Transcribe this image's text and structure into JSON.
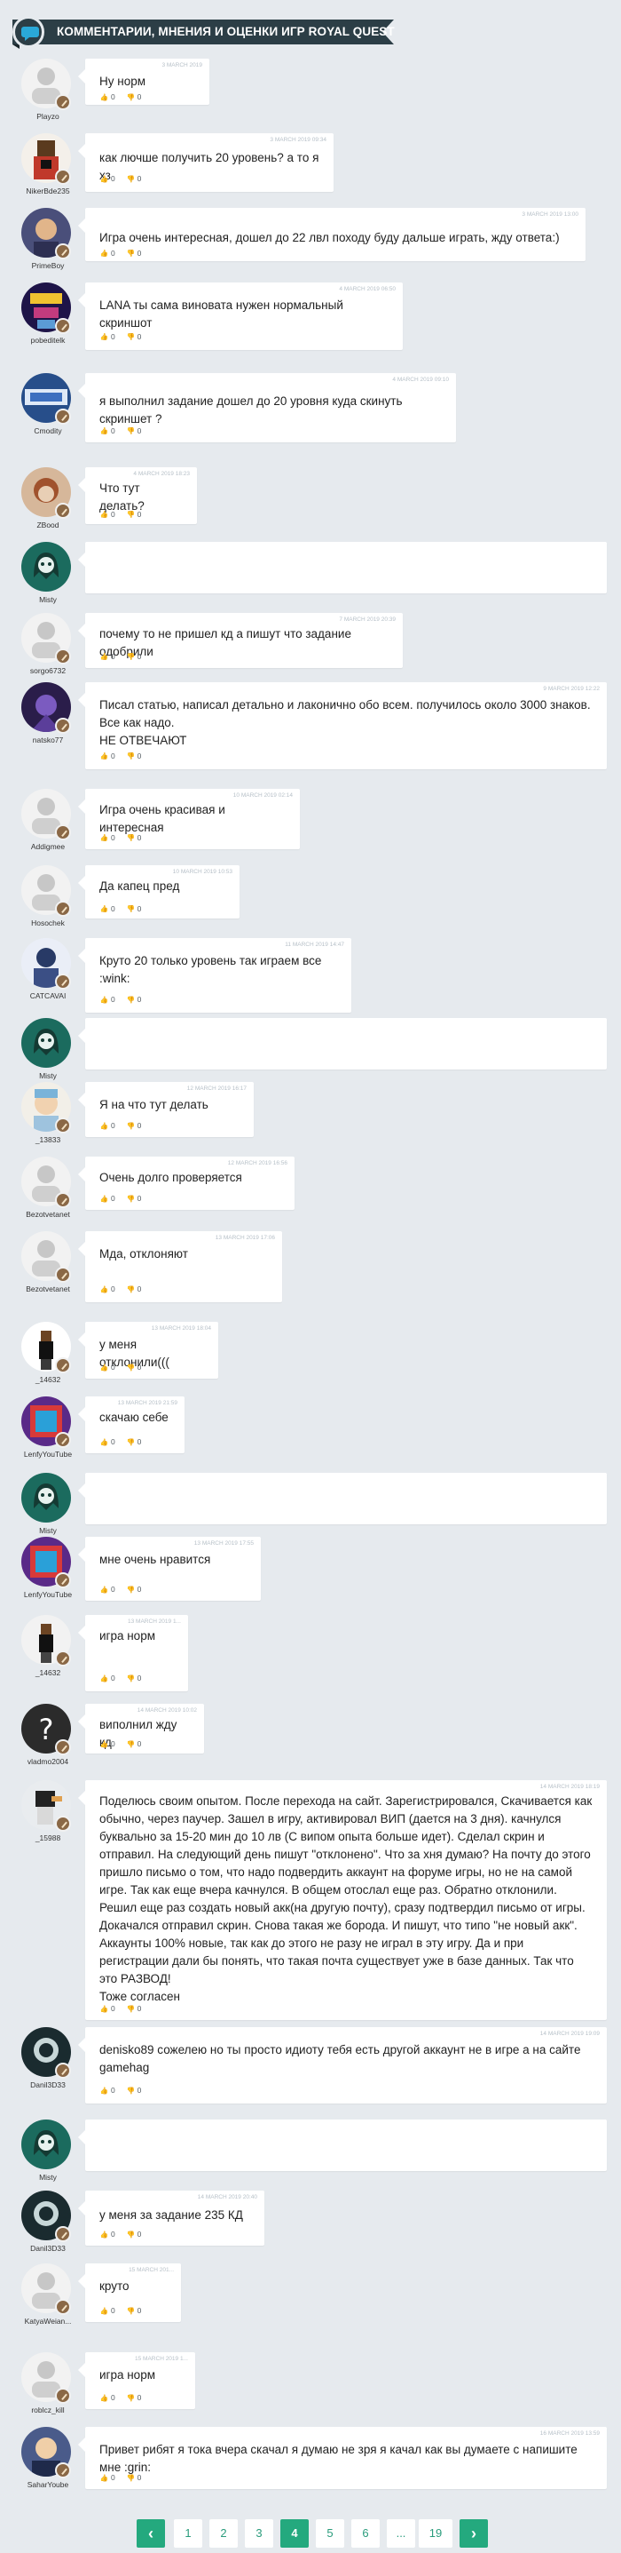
{
  "header": {
    "title": "КОММЕНТАРИИ, МНЕНИЯ И ОЦЕНКИ ИГР ROYAL QUEST"
  },
  "colors": {
    "accent": "#24a97e",
    "header_bg": "#2c3e46",
    "page_bg": "#e6eaee"
  },
  "comments": [
    {
      "user": "Playzo",
      "date": "3 MARCH 2019",
      "text": "Ну норм",
      "likes": "0",
      "dislikes": "0"
    },
    {
      "user": "NikerBde235",
      "date": "3 MARCH 2019 09:34",
      "text": "как лючше получить 20 уровень? а то я хз",
      "likes": "0",
      "dislikes": "0"
    },
    {
      "user": "PrimeBoy",
      "date": "3 MARCH 2019 13:00",
      "text": "Игра очень интересная, дошел до 22 лвл походу буду дальше играть, жду ответа:)",
      "likes": "0",
      "dislikes": "0"
    },
    {
      "user": "pobeditelk",
      "date": "4 MARCH 2019 06:50",
      "text": "LANA ты сама виновата нужен нормальный скриншот",
      "likes": "0",
      "dislikes": "0"
    },
    {
      "user": "Cmodity",
      "date": "4 MARCH 2019 09:10",
      "text": "я выполнил задание дошел до 20 уровня куда скинуть скриншет ?",
      "likes": "0",
      "dislikes": "0"
    },
    {
      "user": "ZBood",
      "date": "4 MARCH 2019 18:23",
      "text": "Что тут делать?",
      "likes": "0",
      "dislikes": "0"
    },
    {
      "user": "Misty",
      "date": "",
      "text": "",
      "likes": "",
      "dislikes": ""
    },
    {
      "user": "sorgo6732",
      "date": "7 MARCH 2019 20:39",
      "text": "почему то не пришел кд а пишут что задание одобрили",
      "likes": "0",
      "dislikes": "0"
    },
    {
      "user": "natsko77",
      "date": "9 MARCH 2019 12:22",
      "text": "Писал статью, написал детально и лаконично обо всем. получилось около 3000 знаков. Все как надо.\nНЕ ОТВЕЧАЮТ",
      "likes": "0",
      "dislikes": "0"
    },
    {
      "user": "Addigmee",
      "date": "10 MARCH 2019 02:14",
      "text": "Игра очень красивая и интересная",
      "likes": "0",
      "dislikes": "0"
    },
    {
      "user": "Hosochek",
      "date": "10 MARCH 2019 10:53",
      "text": "Да капец пред",
      "likes": "0",
      "dislikes": "0"
    },
    {
      "user": "CATCAVAI",
      "date": "11 MARCH 2019 14:47",
      "text": "Круто 20 только уровень так играем все :wink:",
      "likes": "0",
      "dislikes": "0"
    },
    {
      "user": "Misty",
      "date": "",
      "text": "",
      "likes": "",
      "dislikes": ""
    },
    {
      "user": "_13833",
      "date": "12 MARCH 2019 16:17",
      "text": "Я на что тут делать",
      "likes": "0",
      "dislikes": "0"
    },
    {
      "user": "Bezotvetanet",
      "date": "12 MARCH 2019 16:56",
      "text": "Очень долго проверяется",
      "likes": "0",
      "dislikes": "0"
    },
    {
      "user": "Bezotvetanet",
      "date": "13 MARCH 2019 17:06",
      "text": "Мда, отклоняют",
      "likes": "0",
      "dislikes": "0"
    },
    {
      "user": "_14632",
      "date": "13 MARCH 2019 18:04",
      "text": "у меня отклонили(((",
      "likes": "0",
      "dislikes": "0"
    },
    {
      "user": "LenfyYouTube",
      "date": "13 MARCH 2019 21:59",
      "text": "скачаю себе",
      "likes": "0",
      "dislikes": "0"
    },
    {
      "user": "Misty",
      "date": "",
      "text": "",
      "likes": "",
      "dislikes": ""
    },
    {
      "user": "LenfyYouTube",
      "date": "13 MARCH 2019 17:55",
      "text": "мне очень нравится",
      "likes": "0",
      "dislikes": "0"
    },
    {
      "user": "_14632",
      "date": "13 MARCH 2019 1...",
      "text": "игра норм",
      "likes": "0",
      "dislikes": "0"
    },
    {
      "user": "vladmo2004",
      "date": "14 MARCH 2019 10:02",
      "text": "виполнил жду кд",
      "likes": "0",
      "dislikes": "0"
    },
    {
      "user": "_15988",
      "date": "14 MARCH 2019 18:19",
      "text": "Поделюсь своим опытом. После перехода на сайт. Зарегистрировался, Скачивается как обычно, через паучер. Зашел в игру, активировал ВИП (дается на 3 дня). качнулся буквально за 15-20 мин до 10 лв (С випом опыта больше идет). Сделал скрин и отправил. На следующий день пишут \"отклонено\". Что за хня думаю? На почту до этого пришло письмо о том, что надо подвердить аккаунт на форуме игры, но не на самой игре. Так как еще вчера качнулся. В общем отослал еще раз. Обратно отклонили. Решил еще раз создать новый акк(на другую почту), сразу подтвердил письмо от игры. Докачался отправил скрин. Снова такая же борода. И пишут, что типо \"не новый акк\". Аккаунты 100% новые, так как до этого не разу не играл в эту игру. Да и при регистрации дали бы понять, что такая почта существует уже в базе данных. Так что это РАЗВОД!\nТоже согласен",
      "likes": "0",
      "dislikes": "0"
    },
    {
      "user": "Danil3D33",
      "date": "14 MARCH 2019 19:09",
      "text": "denisko89 сожелею но ты просто идиоту тебя есть другой аккаунт не в игре а на сайте gamehag",
      "likes": "0",
      "dislikes": "0"
    },
    {
      "user": "Misty",
      "date": "",
      "text": "",
      "likes": "",
      "dislikes": ""
    },
    {
      "user": "Danil3D33",
      "date": "14 MARCH 2019 20:40",
      "text": "у меня за задание 235 КД",
      "likes": "0",
      "dislikes": "0"
    },
    {
      "user": "KatyaWeian...",
      "date": "15 MARCH 201...",
      "text": "круто",
      "likes": "0",
      "dislikes": "0"
    },
    {
      "user": "roblcz_kill",
      "date": "15 MARCH 2019 1...",
      "text": "игра норм",
      "likes": "0",
      "dislikes": "0"
    },
    {
      "user": "SaharYoube",
      "date": "16 MARCH 2019 13:59",
      "text": "Привет рибят я тока вчера скачал я думаю не зря я качал как вы думаете с напишите мне :grin:",
      "likes": "0",
      "dislikes": "0"
    }
  ],
  "pagination": {
    "prev": "‹",
    "next": "›",
    "pages": [
      "1",
      "2",
      "3",
      "4",
      "5",
      "6",
      "...",
      "19"
    ],
    "active": "4"
  }
}
